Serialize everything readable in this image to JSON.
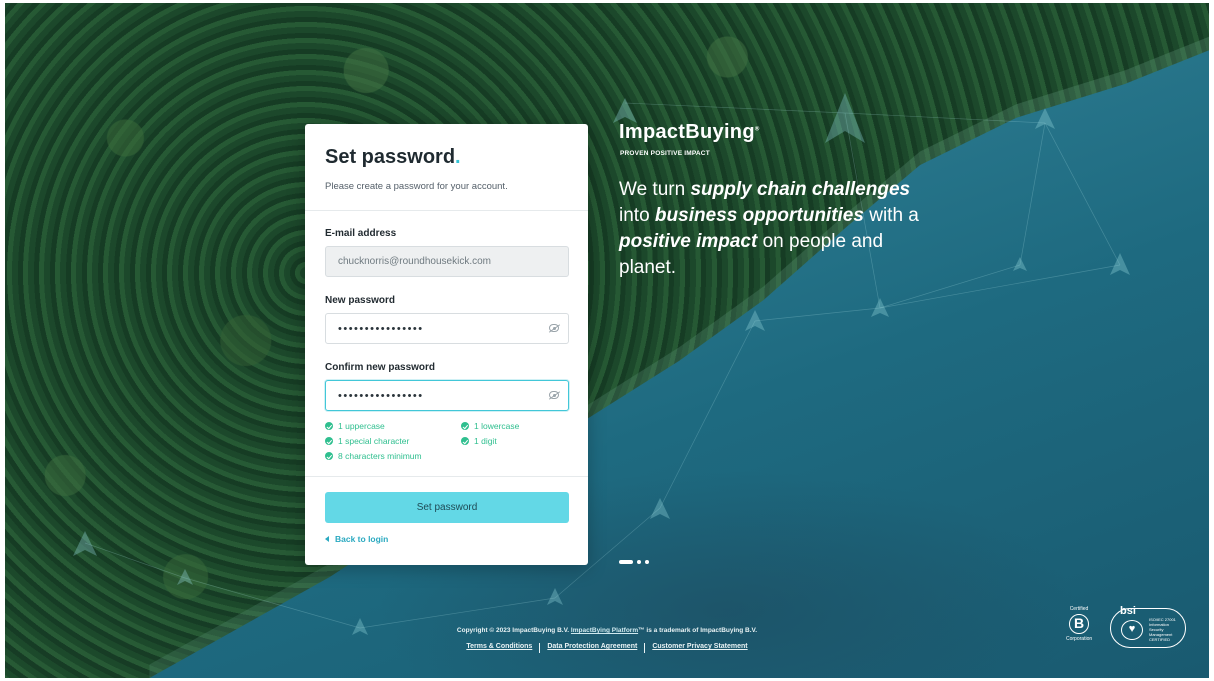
{
  "card": {
    "title": "Set password",
    "title_dot": ".",
    "subtitle": "Please create a password for your account.",
    "email": {
      "label": "E-mail address",
      "value": "chucknorris@roundhousekick.com"
    },
    "new_password": {
      "label": "New password",
      "value": "••••••••••••••••"
    },
    "confirm_password": {
      "label": "Confirm new password",
      "value": "••••••••••••••••"
    },
    "rules": [
      {
        "label": "1 uppercase"
      },
      {
        "label": "1 lowercase"
      },
      {
        "label": "1 special character"
      },
      {
        "label": "1 digit"
      },
      {
        "label": "8 characters minimum"
      }
    ],
    "submit_label": "Set password",
    "back_label": "Back to login"
  },
  "brand": {
    "name": "ImpactBuying",
    "reg": "®",
    "tagline": "PROVEN POSITIVE IMPACT",
    "headline": {
      "p1": "We turn ",
      "b1": "supply chain challenges",
      "p2": " into ",
      "b2": "business opportunities",
      "p3": " with a ",
      "b3": "positive impact",
      "p4": " on people and planet."
    }
  },
  "footer": {
    "copyright_pre": "Copyright © 2023 ImpactBuying B.V. ",
    "platform_link": "ImpactBying Platform",
    "copyright_post": "™ is a trademark of ImpactBuying B.V.",
    "links": [
      "Terms & Conditions",
      "Data Protection Agreement",
      "Customer Privacy Statement"
    ]
  },
  "certs": {
    "b_top": "Certified",
    "b_letter": "B",
    "b_bottom": "Corporation",
    "bsi_logo": "bsi",
    "bsi_text": "ISO/IEC 27001 Information Security Management CERTIFIED"
  },
  "colors": {
    "accent": "#36c4d6",
    "success": "#2fbf8f",
    "button": "#63d8e6"
  }
}
